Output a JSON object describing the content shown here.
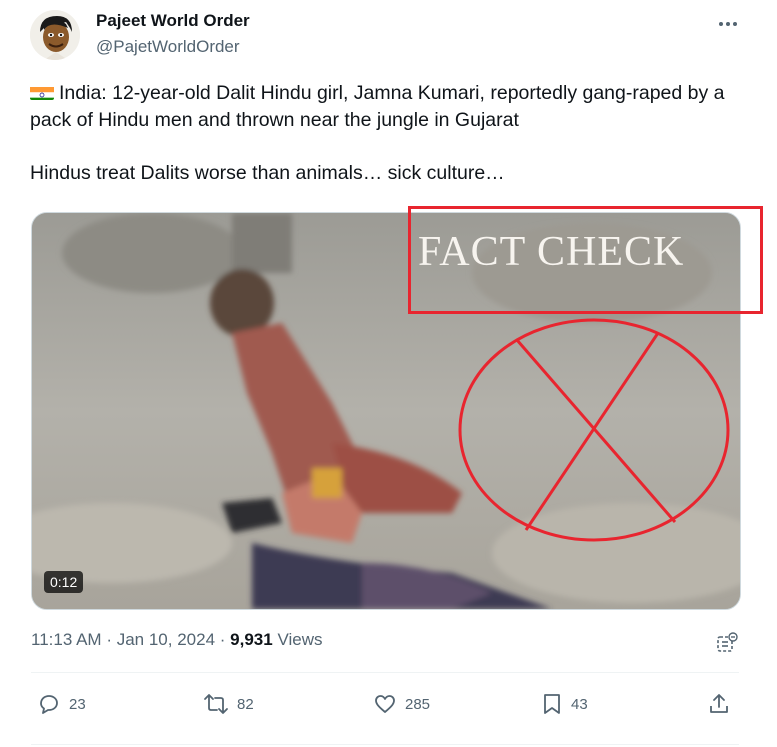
{
  "author": {
    "display_name": "Pajeet World Order",
    "handle": "@PajetWorldOrder"
  },
  "tweet": {
    "flag_icon": "india-flag-emoji",
    "text_line_1": "India: 12-year-old Dalit Hindu girl, Jamna Kumari, reportedly gang-raped by a pack of Hindu men and thrown near the jungle in Gujarat",
    "text_line_2": "Hindus treat Dalits worse than animals… sick culture…"
  },
  "media": {
    "overlay_text": "FACT CHECK",
    "duration": "0:12",
    "accent_color": "#e8252f"
  },
  "meta": {
    "time": "11:13 AM",
    "separator": "·",
    "date": "Jan 10, 2024",
    "views_count": "9,931",
    "views_label": "Views"
  },
  "actions": {
    "replies": "23",
    "reposts": "82",
    "likes": "285",
    "bookmarks": "43"
  },
  "icons": [
    "more-icon",
    "grok-icon",
    "reply-icon",
    "repost-icon",
    "like-icon",
    "bookmark-icon",
    "share-icon"
  ]
}
